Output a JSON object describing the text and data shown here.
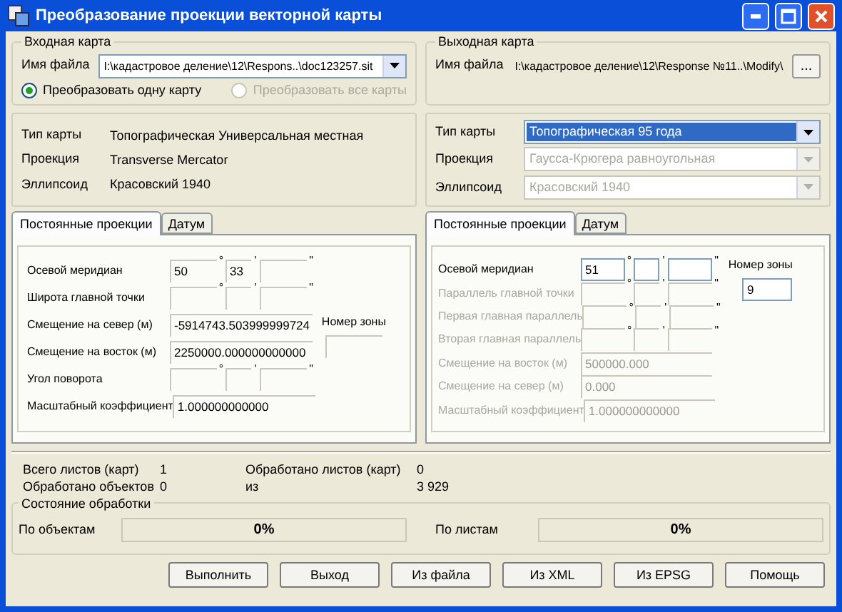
{
  "window": {
    "title": "Преобразование проекции векторной карты"
  },
  "input_map": {
    "title": "Входная карта",
    "file_label": "Имя файла",
    "file_value": "I:\\кадастровое деление\\12\\Respons..\\doc123257.sit",
    "modes": [
      {
        "label": "Преобразовать одну карту",
        "selected": true,
        "disabled": false
      },
      {
        "label": "Преобразовать все карты",
        "selected": false,
        "disabled": true
      }
    ]
  },
  "output_map": {
    "title": "Выходная карта",
    "file_label": "Имя файла",
    "file_value": "I:\\кадастровое деление\\12\\Response №11..\\Modify\\",
    "browse_button": "..."
  },
  "input_info": [
    {
      "label": "Тип карты",
      "value": "Топографическая Универсальная местная"
    },
    {
      "label": "Проекция",
      "value": "Transverse Mercator"
    },
    {
      "label": "Эллипсоид",
      "value": "Красовский 1940"
    }
  ],
  "output_info": [
    {
      "label": "Тип карты",
      "value": "Топографическая 95 года",
      "disabled": false,
      "highlighted": true
    },
    {
      "label": "Проекция",
      "value": "Гаусса-Крюгера равноугольная",
      "disabled": true,
      "highlighted": false
    },
    {
      "label": "Эллипсоид",
      "value": "Красовский 1940",
      "disabled": true,
      "highlighted": false
    }
  ],
  "input_params": {
    "tabs": [
      {
        "label": "Постоянные проекции",
        "selected": true
      },
      {
        "label": "Датум",
        "selected": false
      }
    ],
    "rows": [
      {
        "kind": "dms",
        "label": "Осевой меридиан",
        "degrees": "50",
        "minutes": "33",
        "marks": [
          "°",
          "'",
          "\""
        ],
        "disabled": false
      },
      {
        "kind": "dms",
        "label": "Широта главной точки",
        "marks": [
          "°",
          "'",
          "\""
        ],
        "disabled": false
      },
      {
        "kind": "text",
        "label": "Смещение на север (м)",
        "value": "-5914743.503999999724",
        "disabled": false
      },
      {
        "kind": "text",
        "label": "Смещение на восток (м)",
        "value": "2250000.000000000000",
        "disabled": false
      },
      {
        "kind": "dms",
        "label": "Угол поворота",
        "marks": [
          "°",
          "'",
          "\""
        ],
        "disabled": false
      },
      {
        "kind": "text",
        "label": "Масштабный коэффициент",
        "value": "1.000000000000",
        "disabled": false
      }
    ],
    "zone": {
      "label": "Номер зоны"
    }
  },
  "output_params": {
    "tabs": [
      {
        "label": "Постоянные проекции",
        "selected": true
      },
      {
        "label": "Датум",
        "selected": false
      }
    ],
    "rows": [
      {
        "kind": "dms",
        "label": "Осевой меридиан",
        "degrees": "51",
        "marks": [
          "°",
          "'",
          "\""
        ],
        "disabled": false
      },
      {
        "kind": "dms",
        "label": "Параллель главной точки",
        "marks": [
          "°",
          "'",
          "\""
        ],
        "disabled": true
      },
      {
        "kind": "dms",
        "label": "Первая главная параллель",
        "marks": [
          "°",
          "'",
          "\""
        ],
        "disabled": true
      },
      {
        "kind": "dms",
        "label": "Вторая главная параллель",
        "marks": [
          "°",
          "'",
          "\""
        ],
        "disabled": true
      },
      {
        "kind": "text",
        "label": "Смещение на восток (м)",
        "value": "500000.000",
        "disabled": true
      },
      {
        "kind": "text",
        "label": "Смещение на север (м)",
        "value": "0.000",
        "disabled": true
      },
      {
        "kind": "text",
        "label": "Масштабный коэффициент",
        "value": "1.000000000000",
        "disabled": true
      }
    ],
    "zone": {
      "label": "Номер зоны",
      "value": "9"
    }
  },
  "stats": [
    {
      "label": "Всего листов (карт)",
      "value": "1"
    },
    {
      "label": "Обработано листов (карт)",
      "value": "0"
    },
    {
      "label": "Обработано объектов",
      "value": "0"
    },
    {
      "label": "из",
      "value": "3 929"
    }
  ],
  "progress": {
    "title": "Состояние обработки",
    "bars": [
      {
        "label": "По объектам",
        "text": "0%",
        "level": 0
      },
      {
        "label": "По листам",
        "text": "0%",
        "level": 0
      }
    ]
  },
  "buttons": [
    "Выполнить",
    "Выход",
    "Из файла",
    "Из XML",
    "Из EPSG",
    "Помощь"
  ]
}
